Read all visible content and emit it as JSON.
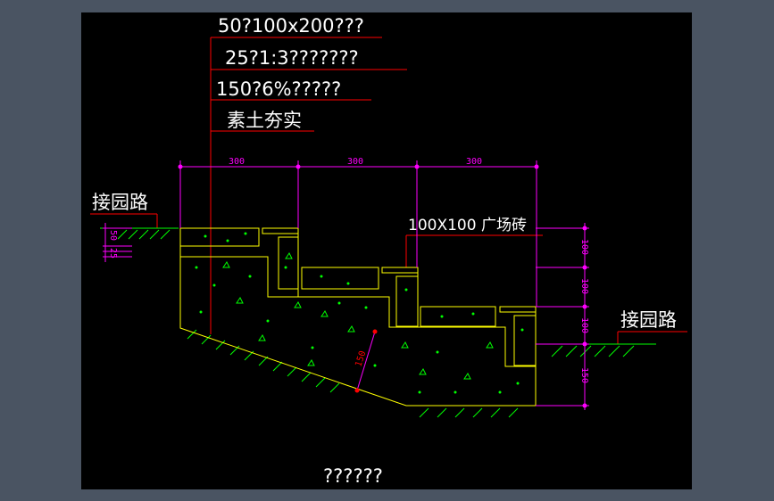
{
  "drawing": {
    "notes": {
      "line1": "50?100x200???",
      "line2": "25?1:3???????",
      "line3": "150?6%?????",
      "line4": "素土夯实"
    },
    "labels": {
      "left_road": "接园路",
      "right_road": "接园路",
      "brick": "100X100 广场砖",
      "bottom_title": "??????"
    },
    "dimensions": {
      "top": [
        "300",
        "300",
        "300"
      ],
      "right": [
        "100",
        "100",
        "100",
        "150"
      ],
      "left_small": [
        "50",
        "25"
      ],
      "slope": "150"
    },
    "colors": {
      "background": "#000000",
      "frame": "#4a5462",
      "concrete": "#ffff00",
      "dimension": "#ff00ff",
      "hatch": "#00ff00",
      "leader": "#ff0000",
      "text": "#ffffff"
    }
  }
}
